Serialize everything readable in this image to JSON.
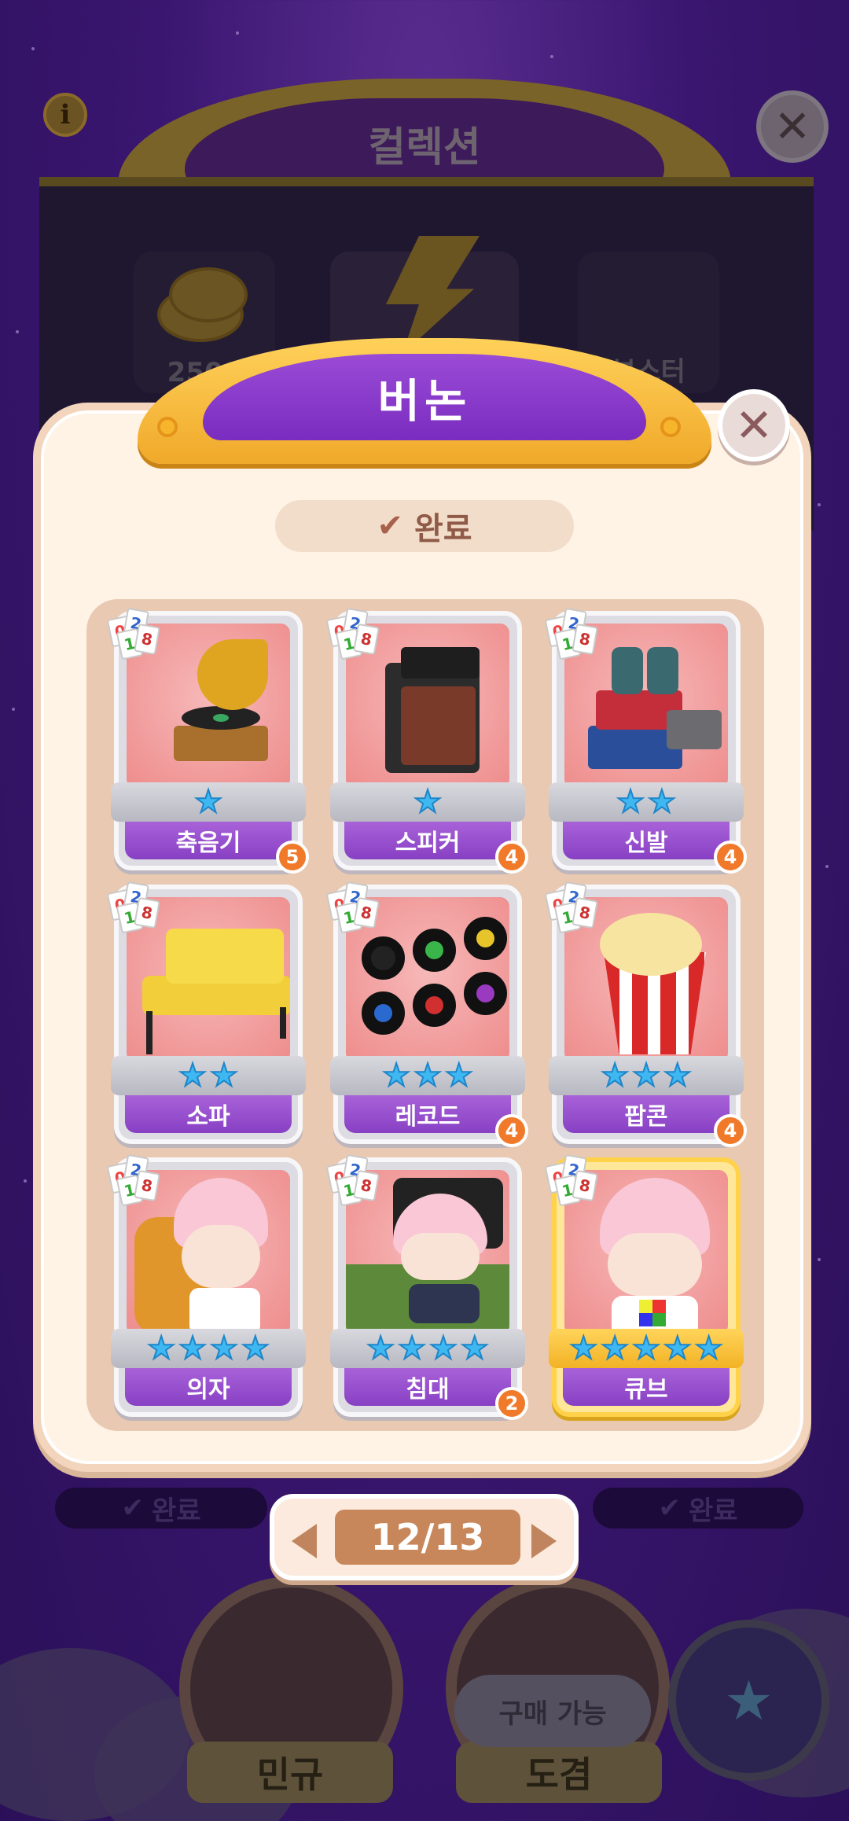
{
  "background": {
    "title": "컬렉션",
    "info_icon": "i",
    "resource_left": "2500",
    "resource_right": "부스터",
    "done_left": "완료",
    "done_right": "완료",
    "nav_left": "민규",
    "nav_right": "도겸",
    "buy_tooltip": "구매 가능"
  },
  "modal": {
    "title": "버논",
    "status": "완료",
    "cards": [
      {
        "name": "축음기",
        "stars": 1,
        "count": "5",
        "gold": false
      },
      {
        "name": "스피커",
        "stars": 1,
        "count": "4",
        "gold": false
      },
      {
        "name": "신발",
        "stars": 2,
        "count": "4",
        "gold": false
      },
      {
        "name": "소파",
        "stars": 2,
        "count": "",
        "gold": false
      },
      {
        "name": "레코드",
        "stars": 3,
        "count": "4",
        "gold": false
      },
      {
        "name": "팝콘",
        "stars": 3,
        "count": "4",
        "gold": false
      },
      {
        "name": "의자",
        "stars": 4,
        "count": "",
        "gold": false
      },
      {
        "name": "침대",
        "stars": 4,
        "count": "2",
        "gold": false
      },
      {
        "name": "큐브",
        "stars": 5,
        "count": "",
        "gold": true
      }
    ],
    "card_tag_digits": [
      "0",
      "2",
      "1",
      "8"
    ]
  },
  "pager": {
    "label": "12/13"
  },
  "icons": {
    "close": "close-icon",
    "check": "check-icon",
    "prev": "prev-arrow-icon",
    "next": "next-arrow-icon",
    "star": "star-icon",
    "chest": "treasure-chest-icon"
  },
  "colors": {
    "primary_purple": "#8840c4",
    "gold": "#f2b225",
    "star_blue": "#3fb8f2",
    "count_orange": "#f07a2a",
    "card_bg_pink": "#ee8c8c"
  }
}
